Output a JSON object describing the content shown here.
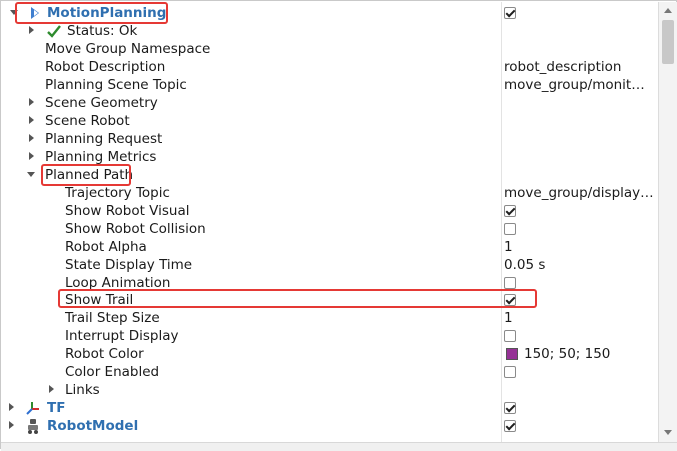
{
  "rows": {
    "motion_planning": "MotionPlanning",
    "status": "Status: Ok",
    "move_group_ns": "Move Group Namespace",
    "robot_description": "Robot Description",
    "robot_description_value": "robot_description",
    "planning_scene_topic": "Planning Scene Topic",
    "planning_scene_topic_value": "move_group/monit…",
    "scene_geometry": "Scene Geometry",
    "scene_robot": "Scene Robot",
    "planning_request": "Planning Request",
    "planning_metrics": "Planning Metrics",
    "planned_path": "Planned Path",
    "trajectory_topic": "Trajectory Topic",
    "trajectory_topic_value": "move_group/display…",
    "show_robot_visual": "Show Robot Visual",
    "show_robot_collision": "Show Robot Collision",
    "robot_alpha": "Robot Alpha",
    "robot_alpha_value": "1",
    "state_display_time": "State Display Time",
    "state_display_time_value": "0.05 s",
    "loop_animation": "Loop Animation",
    "show_trail": "Show Trail",
    "trail_step_size": "Trail Step Size",
    "trail_step_size_value": "1",
    "interrupt_display": "Interrupt Display",
    "robot_color": "Robot Color",
    "robot_color_value": "150; 50; 150",
    "color_enabled": "Color Enabled",
    "links": "Links",
    "tf": "TF",
    "robot_model": "RobotModel"
  },
  "checkboxes": {
    "motion_planning": true,
    "show_robot_visual": true,
    "show_robot_collision": false,
    "loop_animation": false,
    "show_trail": true,
    "interrupt_display": false,
    "color_enabled": false,
    "tf": true,
    "robot_model": true
  },
  "colors": {
    "robot_color_swatch": "#963296",
    "highlight": "#e53935",
    "display_name": "#2f6fb0",
    "status_check": "#2e8b2e"
  },
  "icons": {
    "motion_planning": "motion-planning-icon",
    "status": "checkmark-icon",
    "tf": "tf-axes-icon",
    "robot_model": "robot-model-icon"
  }
}
